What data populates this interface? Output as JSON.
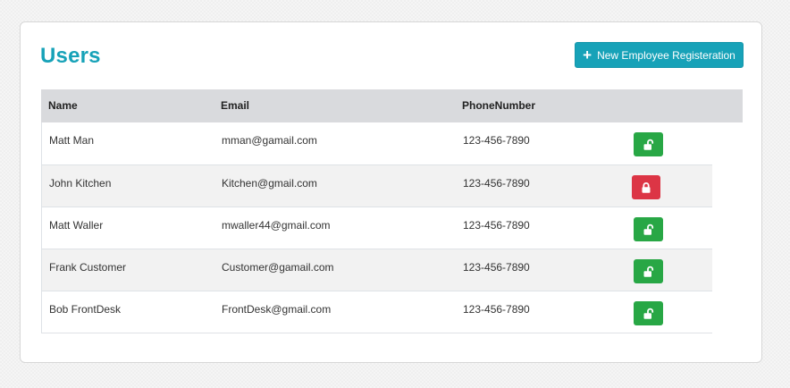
{
  "page": {
    "title": "Users",
    "new_button_label": "New Employee Registeration",
    "new_button_icon": "plus-icon"
  },
  "table": {
    "headers": {
      "name": "Name",
      "email": "Email",
      "phone": "PhoneNumber"
    },
    "rows": [
      {
        "name": "Matt Man",
        "email": "mman@gamail.com",
        "phone": "123-456-7890",
        "lock_state": "unlocked"
      },
      {
        "name": "John Kitchen",
        "email": "Kitchen@gmail.com",
        "phone": "123-456-7890",
        "lock_state": "locked"
      },
      {
        "name": "Matt Waller",
        "email": "mwaller44@gmail.com",
        "phone": "123-456-7890",
        "lock_state": "unlocked"
      },
      {
        "name": "Frank Customer",
        "email": "Customer@gamail.com",
        "phone": "123-456-7890",
        "lock_state": "unlocked"
      },
      {
        "name": "Bob FrontDesk",
        "email": "FrontDesk@gmail.com",
        "phone": "123-456-7890",
        "lock_state": "unlocked"
      }
    ]
  },
  "colors": {
    "accent": "#17a2b8",
    "unlocked": "#28a745",
    "locked": "#dc3545",
    "header_bg": "#d9dadd",
    "stripe_bg": "#f2f2f2"
  }
}
